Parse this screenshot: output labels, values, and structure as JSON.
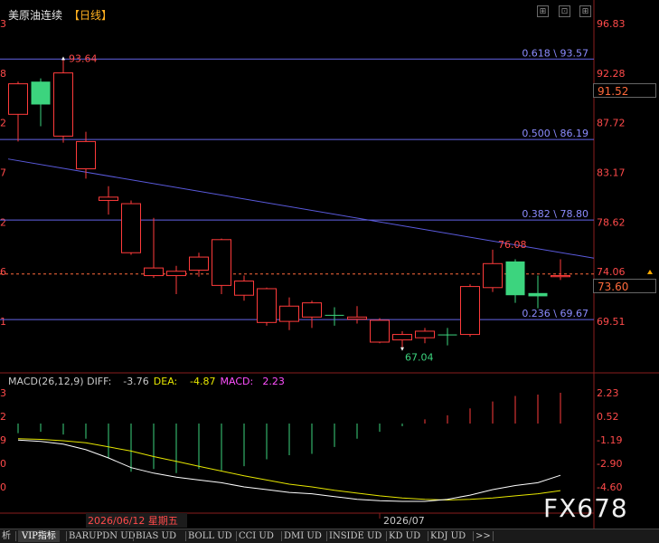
{
  "header": {
    "title": "美原油连续",
    "period": "【日线】",
    "buttons": [
      "⊞",
      "⊡",
      "⊞"
    ]
  },
  "main_price_axis": {
    "ticks": [
      96.83,
      92.28,
      87.72,
      83.17,
      78.62,
      74.06,
      69.51
    ],
    "tick_labels": [
      "96.83",
      "92.28",
      "87.72",
      "83.17",
      "78.62",
      "74.06",
      "69.51"
    ],
    "left_partial_labels": [
      "3",
      "8",
      "2",
      "7",
      "2",
      "6",
      "1"
    ],
    "marker_label": "91.52",
    "current_label": "73.60"
  },
  "candles": [
    {
      "open": 88.5,
      "close": 91.3,
      "high": 91.5,
      "low": 86.0
    },
    {
      "open": 91.5,
      "close": 89.4,
      "high": 91.8,
      "low": 87.4
    },
    {
      "open": 86.5,
      "close": 92.3,
      "high": 93.64,
      "low": 85.9
    },
    {
      "open": 83.5,
      "close": 86.0,
      "high": 86.9,
      "low": 82.6
    },
    {
      "open": 80.6,
      "close": 80.9,
      "high": 81.9,
      "low": 79.3
    },
    {
      "open": 75.8,
      "close": 80.3,
      "high": 80.6,
      "low": 75.6
    },
    {
      "open": 73.7,
      "close": 74.4,
      "high": 79.0,
      "low": 73.5
    },
    {
      "open": 73.7,
      "close": 74.1,
      "high": 74.6,
      "low": 72.0
    },
    {
      "open": 74.2,
      "close": 75.4,
      "high": 75.8,
      "low": 73.6
    },
    {
      "open": 72.8,
      "close": 77.0,
      "high": 77.1,
      "low": 72.0
    },
    {
      "open": 71.9,
      "close": 73.2,
      "high": 73.7,
      "low": 71.4
    },
    {
      "open": 69.4,
      "close": 72.5,
      "high": 72.6,
      "low": 69.1
    },
    {
      "open": 69.5,
      "close": 70.9,
      "high": 71.7,
      "low": 68.7
    },
    {
      "open": 69.9,
      "close": 71.2,
      "high": 71.4,
      "low": 68.9
    },
    {
      "open": 70.1,
      "close": 70.1,
      "high": 70.8,
      "low": 69.1
    },
    {
      "open": 69.7,
      "close": 69.9,
      "high": 70.9,
      "low": 69.3
    },
    {
      "open": 67.6,
      "close": 69.6,
      "high": 69.8,
      "low": 67.5
    },
    {
      "open": 67.8,
      "close": 68.3,
      "high": 68.6,
      "low": 67.04
    },
    {
      "open": 68.0,
      "close": 68.6,
      "high": 68.9,
      "low": 67.5
    },
    {
      "open": 68.3,
      "close": 68.3,
      "high": 68.9,
      "low": 67.3
    },
    {
      "open": 68.3,
      "close": 72.7,
      "high": 72.9,
      "low": 68.1
    },
    {
      "open": 72.6,
      "close": 74.8,
      "high": 76.08,
      "low": 72.2
    },
    {
      "open": 75.0,
      "close": 71.9,
      "high": 75.2,
      "low": 71.2
    },
    {
      "open": 72.1,
      "close": 71.8,
      "high": 73.7,
      "low": 70.7
    },
    {
      "open": 73.6,
      "close": 73.7,
      "high": 75.2,
      "low": 73.3
    }
  ],
  "fibonacci": [
    {
      "ratio": "0.618",
      "value": 93.57,
      "label": "0.618 \\ 93.57"
    },
    {
      "ratio": "0.500",
      "value": 86.19,
      "label": "0.500 \\ 86.19"
    },
    {
      "ratio": "0.382",
      "value": 78.8,
      "label": "0.382 \\ 78.80"
    },
    {
      "ratio": "0.236",
      "value": 69.67,
      "label": "0.236 \\ 69.67"
    }
  ],
  "annotations": {
    "high_label": "93.64",
    "recent_high_label": "76.08",
    "low_label": "67.04"
  },
  "trendline": {
    "start_value": 84.4,
    "end_value": 75.3
  },
  "current_price_line": 73.6,
  "macd": {
    "title": "MACD(26,12,9)",
    "diff_label": "DIFF:",
    "diff_value": "-3.76",
    "dea_label": "DEA:",
    "dea_value": "-4.87",
    "macd_label": "MACD:",
    "macd_value": "2.23",
    "ticks": [
      2.23,
      0.52,
      -1.19,
      -2.9,
      -4.6
    ],
    "tick_labels": [
      "2.23",
      "0.52",
      "-1.19",
      "-2.90",
      "-4.60"
    ],
    "left_partial_labels": [
      "3",
      "2",
      "9",
      "0",
      "0"
    ],
    "bars": [
      -0.7,
      -0.6,
      -0.8,
      -1.1,
      -2.5,
      -3.5,
      -3.3,
      -3.6,
      -3.3,
      -3.4,
      -3.1,
      -2.6,
      -2.3,
      -2.2,
      -1.7,
      -1.1,
      -0.6,
      -0.2,
      0.3,
      0.6,
      1.1,
      1.6,
      2.0,
      2.1,
      2.23
    ],
    "diff": [
      -1.2,
      -1.3,
      -1.5,
      -1.9,
      -2.5,
      -3.2,
      -3.6,
      -3.9,
      -4.1,
      -4.3,
      -4.6,
      -4.8,
      -5.0,
      -5.1,
      -5.3,
      -5.5,
      -5.6,
      -5.65,
      -5.65,
      -5.5,
      -5.2,
      -4.8,
      -4.5,
      -4.3,
      -3.76
    ],
    "dea": [
      -1.1,
      -1.15,
      -1.25,
      -1.4,
      -1.7,
      -2.0,
      -2.4,
      -2.75,
      -3.1,
      -3.45,
      -3.8,
      -4.1,
      -4.4,
      -4.6,
      -4.85,
      -5.05,
      -5.25,
      -5.4,
      -5.5,
      -5.55,
      -5.5,
      -5.4,
      -5.25,
      -5.1,
      -4.87
    ]
  },
  "x_axis": {
    "date_label": "2026/06/12 星期五",
    "month_label": "2026/07"
  },
  "tabs": [
    {
      "label": "析",
      "active": false
    },
    {
      "label": "VIP指标",
      "active": true
    },
    {
      "label": "BARUPDN UD",
      "active": false
    },
    {
      "label": "BIAS UD",
      "active": false
    },
    {
      "label": "BOLL UD",
      "active": false
    },
    {
      "label": "CCI UD",
      "active": false
    },
    {
      "label": "DMI UD",
      "active": false
    },
    {
      "label": "INSIDE UD",
      "active": false
    },
    {
      "label": "KD UD",
      "active": false
    },
    {
      "label": "KDJ UD",
      "active": false
    },
    {
      "label": ">>",
      "active": false
    }
  ],
  "watermark": "FX678",
  "colors": {
    "up": "#ff3b3b",
    "down": "#3cd47e",
    "fib_line": "#6464e6",
    "fib_label": "#8c8cff",
    "trend_line": "#5a5adc",
    "current_line": "#ff6a3c",
    "axis_text": "#ff4a4a",
    "diff_line": "#ffffff",
    "dea_line": "#e6e600",
    "macd_text": "#ff50ff",
    "label_low": "#3cd47e"
  },
  "chart_data": {
    "type": "candlestick",
    "title": "美原油连续【日线】",
    "ylim": [
      65.0,
      96.83
    ],
    "fib_levels": {
      "0.618": 93.57,
      "0.500": 86.19,
      "0.382": 78.8,
      "0.236": 69.67
    },
    "marked_high": 93.64,
    "marked_recent_high": 76.08,
    "marked_low": 67.04,
    "last_price": 73.6,
    "indicator": {
      "name": "MACD(26,12,9)",
      "DIFF": -3.76,
      "DEA": -4.87,
      "MACD": 2.23
    }
  }
}
